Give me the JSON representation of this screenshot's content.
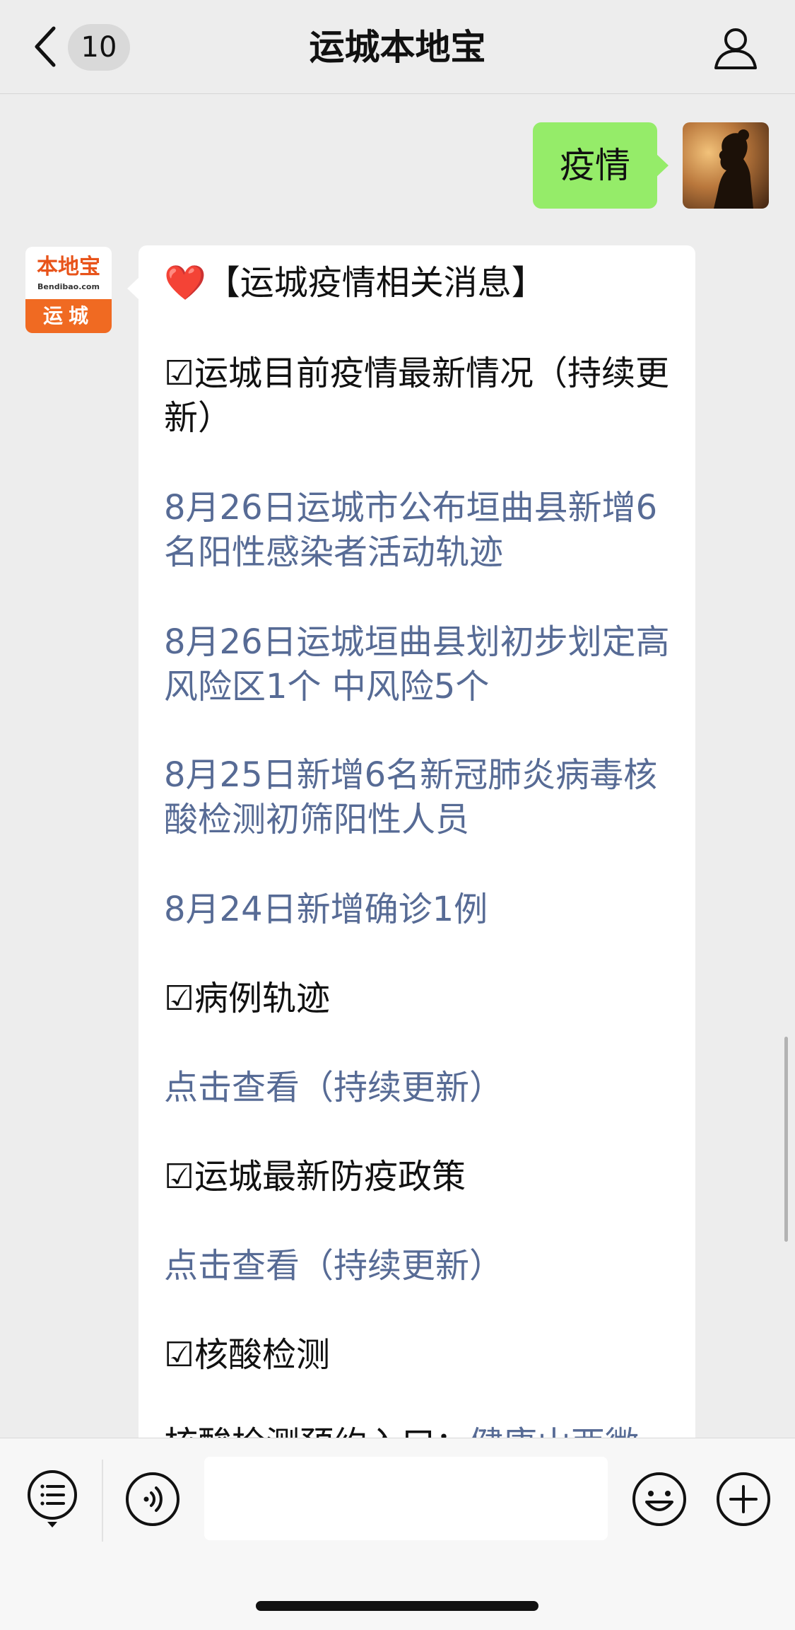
{
  "header": {
    "unread_count": "10",
    "title": "运城本地宝"
  },
  "user_message": {
    "text": "疫情"
  },
  "bot_avatar": {
    "logo_text": "本地宝",
    "logo_url_text": "Bendibao.com",
    "city_text": "运城"
  },
  "bot_message": {
    "heading_icon": "❤️",
    "heading": "【运城疫情相关消息】",
    "items": [
      {
        "type": "plain",
        "text": "☑运城目前疫情最新情况（持续更新）"
      },
      {
        "type": "link",
        "text": "8月26日运城市公布垣曲县新增6名阳性感染者活动轨迹"
      },
      {
        "type": "link",
        "text": "8月26日运城垣曲县划初步划定高风险区1个 中风险5个"
      },
      {
        "type": "link",
        "text": "8月25日新增6名新冠肺炎病毒核酸检测初筛阳性人员"
      },
      {
        "type": "link",
        "text": "8月24日新增确诊1例"
      },
      {
        "type": "plain",
        "text": "☑病例轨迹"
      },
      {
        "type": "link",
        "text": "点击查看（持续更新）"
      },
      {
        "type": "plain",
        "text": "☑运城最新防疫政策"
      },
      {
        "type": "link",
        "text": "点击查看（持续更新）"
      },
      {
        "type": "plain",
        "text": "☑核酸检测"
      },
      {
        "type": "mixed",
        "text": "核酸检测预约入口：",
        "link_text": "健康山西微"
      }
    ]
  },
  "input": {
    "value": "",
    "placeholder": ""
  },
  "colors": {
    "background": "#ededed",
    "user_bubble": "#95ec69",
    "bot_bubble": "#ffffff",
    "link": "#576b95",
    "brand_orange": "#f06a22"
  },
  "icons": {
    "back": "chevron-left-icon",
    "profile": "person-icon",
    "menu": "list-menu-icon",
    "voice": "voice-icon",
    "emoji": "smiley-icon",
    "plus": "plus-circle-icon"
  }
}
